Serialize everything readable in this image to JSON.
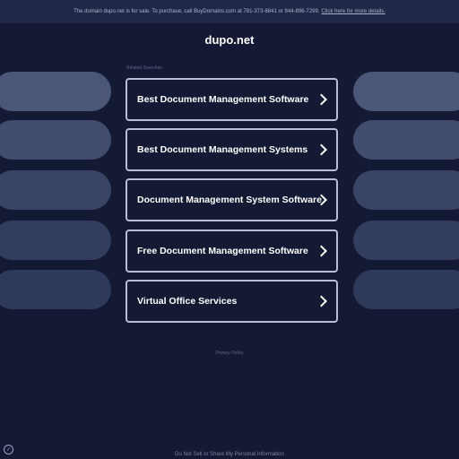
{
  "topbar": {
    "notice": "The domain dupo.net is for sale. To purchase, call BuyDomains.com at 781-373-6841 or 844-896-7299.",
    "link": "Click here for more details."
  },
  "domain": "dupo.net",
  "related_label": "Related Searches",
  "listings": [
    {
      "label": "Best Document Management Software"
    },
    {
      "label": "Best Document Management Systems"
    },
    {
      "label": "Document Management System Software"
    },
    {
      "label": "Free Document Management Software"
    },
    {
      "label": "Virtual Office Services"
    }
  ],
  "privacy_link": "Privacy Policy",
  "footer_link": "Do Not Sell or Share My Personal Information",
  "icons": {
    "chevron": "chevron-right-icon",
    "corner": "privacy-settings-icon"
  },
  "colors": {
    "background": "#141a33",
    "topbar": "#1f2847",
    "pill": "#4b5678",
    "border": "#b8bfd4"
  }
}
